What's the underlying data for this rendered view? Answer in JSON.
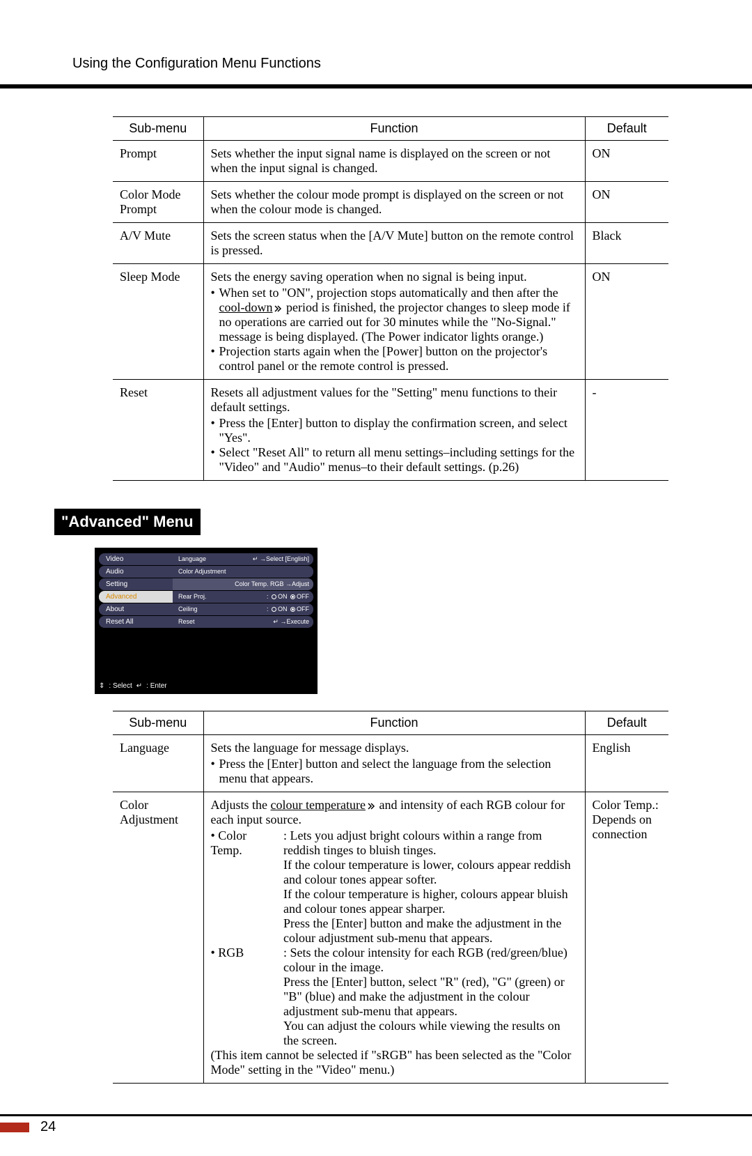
{
  "header": {
    "title": "Using the Configuration Menu Functions"
  },
  "table1": {
    "headers": {
      "h1": "Sub-menu",
      "h2": "Function",
      "h3": "Default"
    },
    "rows": {
      "r0": {
        "submenu": "Prompt",
        "func": "Sets whether the input signal name is displayed on the screen or not when the input signal is changed.",
        "default": "ON"
      },
      "r1": {
        "submenu": "Color Mode Prompt",
        "func": "Sets whether the colour mode prompt is displayed on the screen or not when the colour mode is changed.",
        "default": "ON"
      },
      "r2": {
        "submenu": "A/V Mute",
        "func": "Sets the screen status when the [A/V Mute] button on the remote control is pressed.",
        "default": "Black"
      },
      "r3": {
        "submenu": "Sleep Mode",
        "intro": "Sets the energy saving operation when no signal is being input.",
        "b1a": "When set to \"ON\", projection stops automatically and then after the ",
        "b1b": "cool-down",
        "b1c": " period is finished, the projector changes to sleep mode if no operations are carried out for 30 minutes while the \"No-Signal.\" message is being displayed. (The Power indicator lights orange.)",
        "b2": "Projection starts again when the [Power] button on the projector's control panel or the remote control is pressed.",
        "default": "ON"
      },
      "r4": {
        "submenu": "Reset",
        "intro": "Resets all adjustment values for the \"Setting\" menu functions to their default settings.",
        "b1": "Press the [Enter] button to display the confirmation screen, and select \"Yes\".",
        "b2": "Select \"Reset All\" to return all menu settings–including settings for the \"Video\" and \"Audio\" menus–to their default settings. (p.26)",
        "default": "-"
      }
    }
  },
  "sections": {
    "advanced": {
      "title": "\"Advanced\" Menu"
    }
  },
  "menushot": {
    "tabs": {
      "t0": "Video",
      "t1": "Audio",
      "t2": "Setting",
      "t3": "Advanced",
      "t4": "About",
      "t5": "Reset All"
    },
    "rows": {
      "language": {
        "label": "Language",
        "right": "→Select   [English]"
      },
      "coloradj": {
        "label": "Color Adjustment"
      },
      "coloradj_sub": {
        "left": "",
        "right": "Color Temp.   RGB   →Adjust"
      },
      "rearproj": {
        "label": "Rear Proj.",
        "on": "ON",
        "off": "OFF"
      },
      "ceiling": {
        "label": "Ceiling",
        "on": "ON",
        "off": "OFF"
      },
      "reset": {
        "label": "Reset",
        "right": "→Execute"
      }
    },
    "footer": {
      "sel": " : Select",
      "ent": " : Enter"
    }
  },
  "table2": {
    "headers": {
      "h1": "Sub-menu",
      "h2": "Function",
      "h3": "Default"
    },
    "rows": {
      "r0": {
        "submenu": "Language",
        "l1": "Sets the language for message displays.",
        "b1": "Press the [Enter] button and select the language from the selection menu that appears.",
        "default": "English"
      },
      "r1": {
        "submenu": "Color Adjustment",
        "intro_a": "Adjusts the ",
        "intro_b": "colour temperature",
        "intro_c": " and intensity of each RGB colour for each input source.",
        "ct_label": "• Color Temp.",
        "ct_d1": ": Lets you adjust bright colours within a range from reddish tinges to bluish tinges.",
        "ct_d2": "If the colour temperature is lower, colours appear reddish and colour tones appear softer.",
        "ct_d3": "If the colour temperature is higher, colours appear bluish and colour tones appear sharper.",
        "ct_d4": "Press the [Enter] button and make the adjustment in the colour adjustment sub-menu that appears.",
        "rgb_label": "• RGB",
        "rgb_d1": ": Sets the colour intensity for each RGB (red/green/blue) colour in the image.",
        "rgb_d2": "Press the [Enter] button, select \"R\" (red), \"G\" (green) or \"B\" (blue) and make the adjustment in the colour adjustment sub-menu that appears.",
        "rgb_d3": "You can adjust the colours while viewing the results on the screen.",
        "note": "(This item cannot be selected if \"sRGB\" has been selected as the \"Color Mode\" setting in the \"Video\" menu.)",
        "default": "Color Temp.: Depends on connection"
      }
    }
  },
  "page_number": "24"
}
